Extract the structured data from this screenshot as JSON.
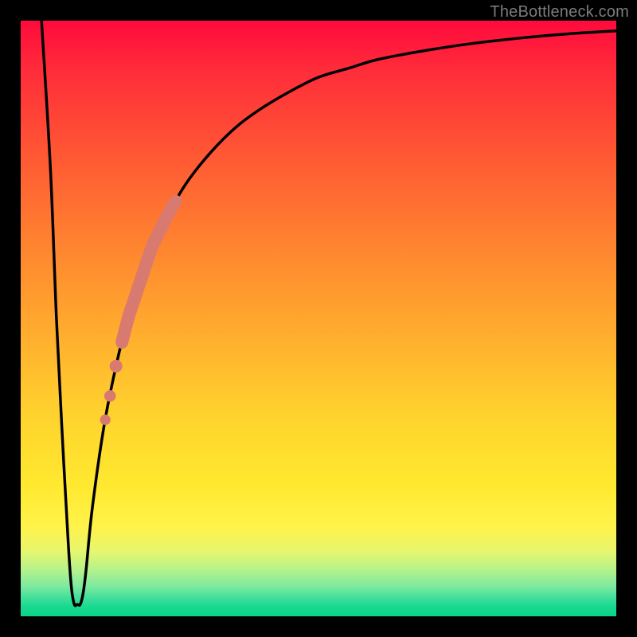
{
  "watermark": "TheBottleneck.com",
  "colors": {
    "curve": "#000000",
    "highlight": "#d87a6f",
    "frame": "#000000"
  },
  "chart_data": {
    "type": "line",
    "title": "",
    "xlabel": "",
    "ylabel": "",
    "xlim": [
      0,
      100
    ],
    "ylim": [
      0,
      100
    ],
    "grid": false,
    "legend": false,
    "series": [
      {
        "name": "bottleneck-curve",
        "x": [
          3.5,
          5,
          6,
          7,
          8,
          8.5,
          9,
          9.5,
          10,
          10.5,
          11,
          12,
          14,
          16,
          18,
          20,
          22,
          25,
          28,
          32,
          36,
          40,
          45,
          50,
          55,
          60,
          68,
          76,
          85,
          92,
          100
        ],
        "y": [
          100,
          75,
          50,
          30,
          12,
          5,
          2,
          2,
          2,
          4,
          8,
          18,
          32,
          42,
          50,
          56,
          62,
          68,
          73,
          78,
          82,
          85,
          88,
          90.5,
          92,
          93.5,
          95,
          96.2,
          97.2,
          97.8,
          98.3
        ]
      }
    ],
    "highlight_segment": {
      "series": "bottleneck-curve",
      "x_start": 17,
      "x_end": 26,
      "style": "thick"
    },
    "highlight_dots": {
      "series": "bottleneck-curve",
      "x": [
        16.0,
        15.0,
        14.2
      ]
    }
  }
}
